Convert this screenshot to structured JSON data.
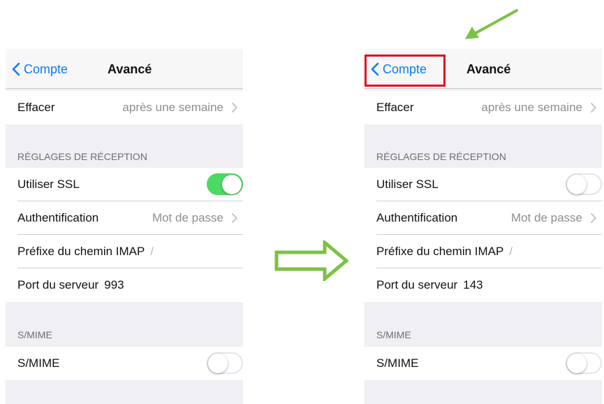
{
  "colors": {
    "accent": "#0a7cf6",
    "toggle_on": "#4cd964",
    "highlight": "#e0101b",
    "arrow_green": "#7cc242"
  },
  "screens": [
    {
      "nav": {
        "back_label": "Compte",
        "title": "Avancé"
      },
      "delete_row": {
        "label": "Effacer",
        "value": "après une semaine"
      },
      "receive_section": {
        "header": "RÉGLAGES DE RÉCEPTION"
      },
      "ssl_row": {
        "label": "Utiliser SSL",
        "toggle_state": "on"
      },
      "auth_row": {
        "label": "Authentification",
        "value": "Mot de passe"
      },
      "imap_row": {
        "label": "Préfixe du chemin IMAP",
        "value": "/"
      },
      "port_row": {
        "label": "Port du serveur",
        "value": "993"
      },
      "smime_section": {
        "header": "S/MIME"
      },
      "smime_row": {
        "label": "S/MIME",
        "toggle_state": "off"
      }
    },
    {
      "nav": {
        "back_label": "Compte",
        "title": "Avancé"
      },
      "delete_row": {
        "label": "Effacer",
        "value": "après une semaine"
      },
      "receive_section": {
        "header": "RÉGLAGES DE RÉCEPTION"
      },
      "ssl_row": {
        "label": "Utiliser SSL",
        "toggle_state": "off"
      },
      "auth_row": {
        "label": "Authentification",
        "value": "Mot de passe"
      },
      "imap_row": {
        "label": "Préfixe du chemin IMAP",
        "value": "/"
      },
      "port_row": {
        "label": "Port du serveur",
        "value": "143"
      },
      "smime_section": {
        "header": "S/MIME"
      },
      "smime_row": {
        "label": "S/MIME",
        "toggle_state": "off"
      }
    }
  ],
  "icons": {
    "back": "chevron-left-icon",
    "disclosure": "chevron-right-icon",
    "flow_arrow": "outline-right-arrow-icon",
    "pointer_arrow": "diagonal-pointer-arrow-icon"
  }
}
